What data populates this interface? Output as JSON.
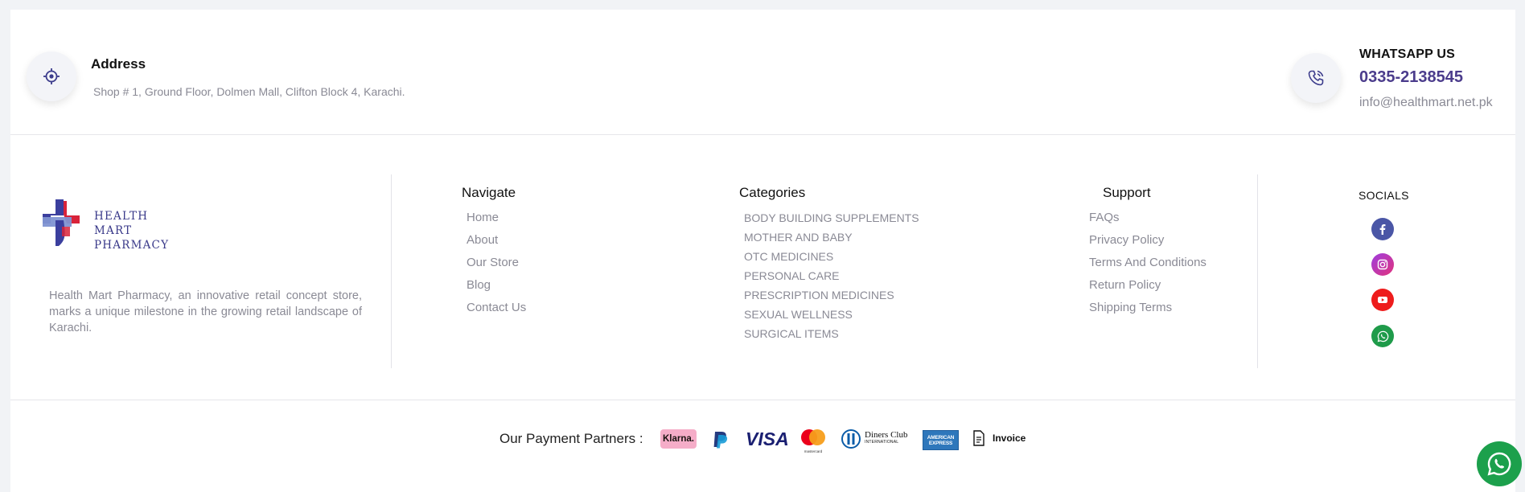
{
  "contact": {
    "address_title": "Address",
    "address_text": "Shop # 1, Ground Floor, Dolmen Mall, Clifton Block 4, Karachi.",
    "whatsapp_title": "WHATSAPP US",
    "phone": "0335-2138545",
    "email": "info@healthmart.net.pk"
  },
  "brand": {
    "name_line1": "HEALTH MART",
    "name_line2": "PHARMACY",
    "description": "Health Mart Pharmacy, an innovative retail concept store, marks a unique milestone in the growing retail landscape of Karachi."
  },
  "navigate": {
    "title": "Navigate",
    "items": [
      "Home",
      "About",
      "Our Store",
      "Blog",
      "Contact Us"
    ]
  },
  "categories": {
    "title": "Categories",
    "items": [
      "BODY BUILDING SUPPLEMENTS",
      "MOTHER AND BABY",
      "OTC MEDICINES",
      "PERSONAL CARE",
      "PRESCRIPTION MEDICINES",
      "SEXUAL WELLNESS",
      "SURGICAL ITEMS"
    ]
  },
  "support": {
    "title": "Support",
    "items": [
      "FAQs",
      "Privacy Policy",
      "Terms And Conditions",
      "Return Policy",
      "Shipping Terms"
    ]
  },
  "socials": {
    "title": "SOCIALS",
    "icons": [
      "facebook-icon",
      "instagram-icon",
      "youtube-icon",
      "whatsapp-icon"
    ]
  },
  "payment": {
    "label": "Our Payment Partners :",
    "partners": {
      "klarna": "Klarna.",
      "visa": "VISA",
      "mastercard": "mastercard",
      "diners": "Diners Club",
      "diners_sub": "INTERNATIONAL",
      "amex": "AMERICAN EXPRESS",
      "invoice": "Invoice"
    }
  },
  "colors": {
    "accent": "#4b3c8c",
    "muted_text": "#8a8a95",
    "whatsapp_green": "#1ca04c"
  }
}
